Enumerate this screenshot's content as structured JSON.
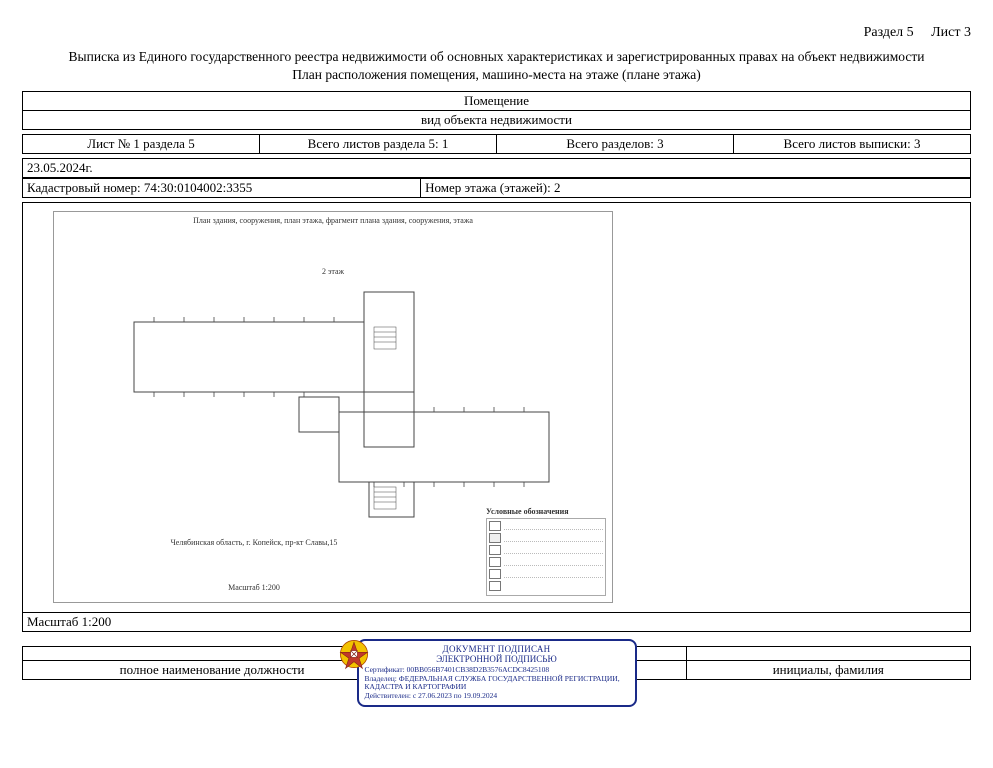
{
  "header": {
    "section": "Раздел 5",
    "sheet": "Лист 3",
    "title_main": "Выписка из Единого государственного реестра недвижимости об основных характеристиках и зарегистрированных правах на объект недвижимости",
    "title_sub": "План расположения помещения, машино-места на этаже (плане этажа)"
  },
  "obj_rows": {
    "r1": "Помещение",
    "r2": "вид объекта недвижимости"
  },
  "counts": {
    "c1": "Лист № 1 раздела 5",
    "c2": "Всего листов раздела 5: 1",
    "c3": "Всего разделов: 3",
    "c4": "Всего листов выписки: 3"
  },
  "date": "23.05.2024г.",
  "cadastral_label": "Кадастровый номер: 74:30:0104002:3355",
  "floor_label": "Номер этажа (этажей): 2",
  "plan": {
    "caption": "План здания, сооружения, план этажа, фрагмент плана здания, сооружения, этажа",
    "floor": "2 этаж",
    "address": "Челябинская область, г. Копейск,  пр-кт Славы,15",
    "scale_small": "Масштаб 1:200",
    "legend_title": "Условные обозначения"
  },
  "scale_row": "Масштаб 1:200",
  "footer": {
    "left": "полное наименование должности",
    "right": "инициалы, фамилия"
  },
  "signature": {
    "h1": "ДОКУМЕНТ ПОДПИСАН",
    "h2": "ЭЛЕКТРОННОЙ ПОДПИСЬЮ",
    "cert": "Сертификат: 00BB056B7401CB38D2B3576ACDC8425108",
    "owner": "Владелец: ФЕДЕРАЛЬНАЯ СЛУЖБА ГОСУДАРСТВЕННОЙ РЕГИСТРАЦИИ, КАДАСТРА И КАРТОГРАФИИ",
    "valid": "Действителен: с 27.06.2023 по 19.09.2024"
  }
}
